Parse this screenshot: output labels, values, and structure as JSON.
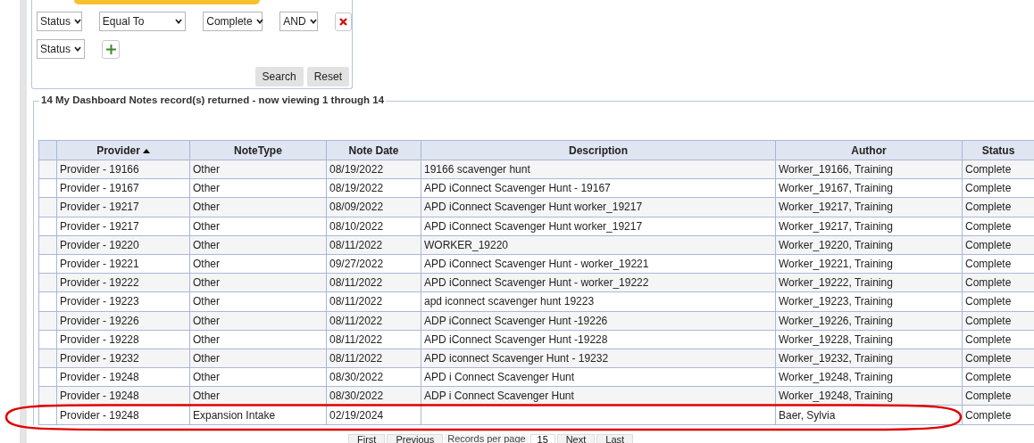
{
  "filter": {
    "rows": [
      {
        "kind": "condition",
        "field": "Status",
        "operator": "Equal To",
        "value": "Complete",
        "conjunction": "AND"
      },
      {
        "kind": "new",
        "field": "Status"
      }
    ],
    "buttons": [
      "Search",
      "Reset"
    ]
  },
  "results": {
    "legend": "14 My Dashboard Notes record(s) returned - now viewing 1 through 14",
    "columns": [
      {
        "sorted": false
      },
      {
        "label": "Provider",
        "sorted": true
      },
      {
        "label": "NoteType",
        "sorted": false
      },
      {
        "label": "Note Date",
        "sorted": false
      },
      {
        "label": "Description",
        "sorted": false
      },
      {
        "label": "Author",
        "sorted": false
      },
      {
        "label": "Status",
        "sorted": false
      }
    ],
    "rows": [
      [
        "",
        "Provider - 19166",
        "Other",
        "08/19/2022",
        "19166 scavenger hunt",
        "Worker_19166, Training",
        "Complete"
      ],
      [
        "",
        "Provider - 19167",
        "Other",
        "08/19/2022",
        "APD iConnect Scavenger Hunt - 19167",
        "Worker_19167, Training",
        "Complete"
      ],
      [
        "",
        "Provider - 19217",
        "Other",
        "08/09/2022",
        "APD iConnect Scavenger Hunt worker_19217",
        "Worker_19217, Training",
        "Complete"
      ],
      [
        "",
        "Provider - 19217",
        "Other",
        "08/10/2022",
        "APD iConnect Scavenger Hunt worker_19217",
        "Worker_19217, Training",
        "Complete"
      ],
      [
        "",
        "Provider - 19220",
        "Other",
        "08/11/2022",
        "WORKER_19220",
        "Worker_19220, Training",
        "Complete"
      ],
      [
        "",
        "Provider - 19221",
        "Other",
        "09/27/2022",
        "APD iConnect Scavenger Hunt - worker_19221",
        "Worker_19221, Training",
        "Complete"
      ],
      [
        "",
        "Provider - 19222",
        "Other",
        "08/11/2022",
        "APD iConnect Scavenger Hunt - worker_19222",
        "Worker_19222, Training",
        "Complete"
      ],
      [
        "",
        "Provider - 19223",
        "Other",
        "08/11/2022",
        "apd iconnect scavenger hunt 19223",
        "Worker_19223, Training",
        "Complete"
      ],
      [
        "",
        "Provider - 19226",
        "Other",
        "08/11/2022",
        "ADP iConnect Scavenger Hunt -19226",
        "Worker_19226, Training",
        "Complete"
      ],
      [
        "",
        "Provider - 19228",
        "Other",
        "08/11/2022",
        "APD iConnect Scavenger Hunt -19228",
        "Worker_19228, Training",
        "Complete"
      ],
      [
        "",
        "Provider - 19232",
        "Other",
        "08/11/2022",
        "APD iconnect Scavenger Hunt - 19232",
        "Worker_19232, Training",
        "Complete"
      ],
      [
        "",
        "Provider - 19248",
        "Other",
        "08/30/2022",
        "APD i Connect Scavenger Hunt",
        "Worker_19248, Training",
        "Complete"
      ],
      [
        "",
        "Provider - 19248",
        "Other",
        "08/30/2022",
        "ADP i Connect Scavenger Hunt",
        "Worker_19248, Training",
        "Complete"
      ],
      [
        "",
        "Provider - 19248",
        "Expansion Intake",
        "02/19/2024",
        "",
        "Baer, Sylvia",
        "Complete"
      ]
    ]
  },
  "pager": {
    "first": "First",
    "previous": "Previous",
    "records_label": "Records per page",
    "per_page": "15",
    "next": "Next",
    "last": "Last"
  }
}
